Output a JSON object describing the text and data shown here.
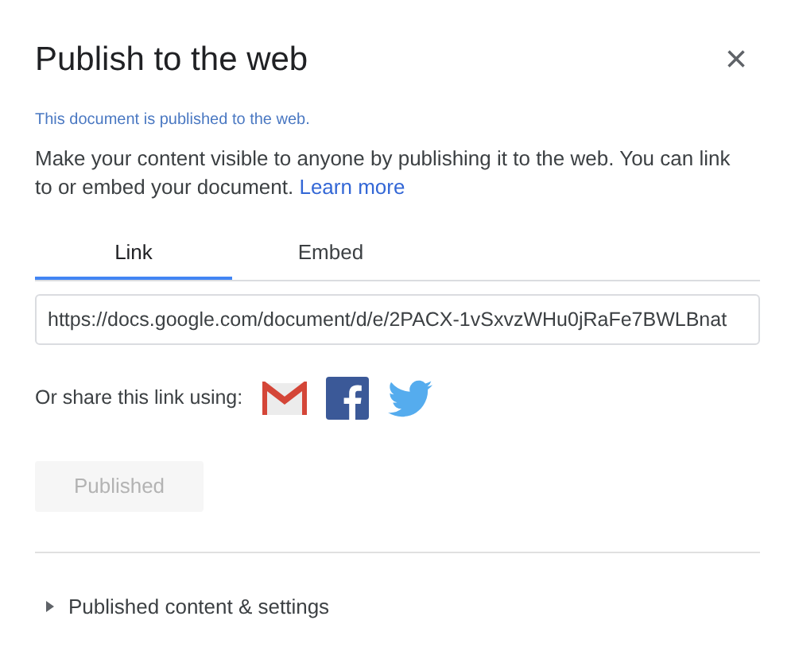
{
  "dialog": {
    "title": "Publish to the web",
    "close": "×"
  },
  "status": "This document is published to the web.",
  "description": "Make your content visible to anyone by publishing it to the web. You can link to or embed your document.",
  "learn_more": "Learn more",
  "tabs": [
    {
      "label": "Link",
      "selected": true
    },
    {
      "label": "Embed",
      "selected": false
    }
  ],
  "link_field": {
    "value": "https://docs.google.com/document/d/e/2PACX-1vSxvzWHu0jRaFe7BWLBnat"
  },
  "share": {
    "label": "Or share this link using:",
    "services": [
      {
        "kind": "gmail"
      },
      {
        "kind": "facebook"
      },
      {
        "kind": "twitter"
      }
    ]
  },
  "publish_button": {
    "label": "Published",
    "disabled": true
  },
  "settings": {
    "label": "Published content & settings",
    "expanded": false
  }
}
